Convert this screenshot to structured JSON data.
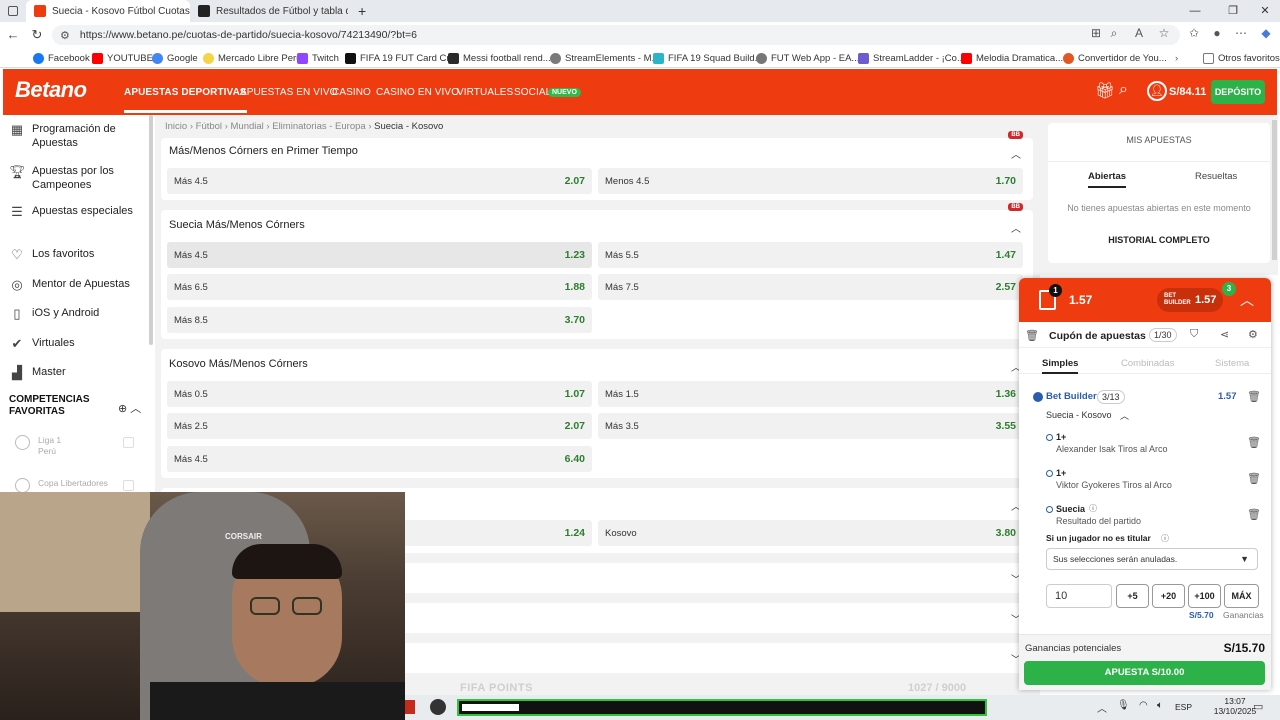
{
  "browser": {
    "tabs": [
      {
        "label": "Suecia - Kosovo Fútbol Cuotas | B",
        "color": "#ee3c10"
      },
      {
        "label": "Resultados de Fútbol y tabla de p",
        "color": "#222222"
      }
    ],
    "url": "https://www.betano.pe/cuotas-de-partido/suecia-kosovo/74213490/?bt=6",
    "bookmarks": [
      {
        "label": "Facebook",
        "color": "#1877f2"
      },
      {
        "label": "YOUTUBE",
        "color": "#ff0000"
      },
      {
        "label": "Google",
        "color": "#4285f4"
      },
      {
        "label": "Mercado Libre Perú",
        "color": "#f5d44a"
      },
      {
        "label": "Twitch",
        "color": "#9146ff"
      },
      {
        "label": "FIFA 19 FUT Card Cr...",
        "color": "#111111"
      },
      {
        "label": "Messi football rend...",
        "color": "#2b2b2b"
      },
      {
        "label": "StreamElements - M...",
        "color": "#7a7a7a"
      },
      {
        "label": "FIFA 19 Squad Build...",
        "color": "#2bb5c8"
      },
      {
        "label": "FUT Web App - EA...",
        "color": "#777777"
      },
      {
        "label": "StreamLadder - ¡Co...",
        "color": "#6d5bd0"
      },
      {
        "label": "Melodia Dramatica...",
        "color": "#ff0000"
      },
      {
        "label": "Convertidor de You...",
        "color": "#e25822"
      }
    ],
    "other_bookmarks": "Otros favoritos"
  },
  "header": {
    "logo": "Betano",
    "nav": [
      "APUESTAS DEPORTIVAS",
      "APUESTAS EN VIVO",
      "CASINO",
      "CASINO EN VIVO",
      "VIRTUALES",
      "SOCIAL"
    ],
    "nuevo": "NUEVO",
    "balance": "S/84.11",
    "deposit": "DEPÓSITO",
    "brand_color": "#ee3c10"
  },
  "sidebar": {
    "items": [
      {
        "label": "Programación de Apuestas",
        "icon": "calendar-icon"
      },
      {
        "label": "Apuestas por los Campeones",
        "icon": "trophy-icon"
      },
      {
        "label": "Apuestas especiales",
        "icon": "sliders-icon"
      },
      {
        "label": "Los favoritos",
        "icon": "heart-icon"
      },
      {
        "label": "Mentor de Apuestas",
        "icon": "target-icon"
      },
      {
        "label": "iOS y Android",
        "icon": "phone-icon"
      },
      {
        "label": "Virtuales",
        "icon": "check-icon"
      },
      {
        "label": "Master",
        "icon": "chart-icon"
      }
    ],
    "competitions_title": "COMPETENCIAS FAVORITAS",
    "leagues": [
      {
        "name": "Liga 1",
        "country": "Perú"
      },
      {
        "name": "Copa Libertadores",
        "country": ""
      }
    ]
  },
  "breadcrumb": {
    "items": [
      "Inicio",
      "Fútbol",
      "Mundial",
      "Eliminatorias - Europa"
    ],
    "current": "Suecia - Kosovo"
  },
  "markets": [
    {
      "title": "Más/Menos Córners en Primer Tiempo",
      "badge": "BB",
      "odds": [
        {
          "label": "Más 4.5",
          "value": "2.07"
        },
        {
          "label": "Menos 4.5",
          "value": "1.70"
        }
      ]
    },
    {
      "title": "Suecia Más/Menos Córners",
      "badge": "BB",
      "odds": [
        {
          "label": "Más 4.5",
          "value": "1.23"
        },
        {
          "label": "Más 5.5",
          "value": "1.47"
        },
        {
          "label": "Más 6.5",
          "value": "1.88"
        },
        {
          "label": "Más 7.5",
          "value": "2.57"
        },
        {
          "label": "Más 8.5",
          "value": "3.70"
        }
      ]
    },
    {
      "title": "Kosovo Más/Menos Córners",
      "badge": "",
      "odds": [
        {
          "label": "Más 0.5",
          "value": "1.07"
        },
        {
          "label": "Más 1.5",
          "value": "1.36"
        },
        {
          "label": "Más 2.5",
          "value": "2.07"
        },
        {
          "label": "Más 3.5",
          "value": "3.55"
        },
        {
          "label": "Más 4.5",
          "value": "6.40"
        }
      ]
    },
    {
      "title": "",
      "badge": "",
      "odds": [
        {
          "label": "",
          "value": "1.24"
        },
        {
          "label": "Kosovo",
          "value": "3.80"
        }
      ]
    }
  ],
  "my_bets": {
    "title": "MIS APUESTAS",
    "tabs": [
      "Abiertas",
      "Resueltas"
    ],
    "empty": "No tienes apuestas abiertas en este momento",
    "history": "HISTORIAL COMPLETO"
  },
  "coupon": {
    "count": "1",
    "total_odds": "1.57",
    "bb_odds": "1.57",
    "bb_count": "3",
    "title": "Cupón de apuestas",
    "pager": "1/30",
    "tabs": [
      "Simples",
      "Combinadas",
      "Sistema"
    ],
    "builder_label": "Bet Builder",
    "builder_count": "3/13",
    "builder_odds": "1.57",
    "match": "Suecia - Kosovo",
    "selections": [
      {
        "pick": "1+",
        "market": "Alexander Isak Tiros al Arco"
      },
      {
        "pick": "1+",
        "market": "Viktor Gyokeres Tiros al Arco"
      },
      {
        "pick": "Suecia",
        "market": "Resultado del partido"
      }
    ],
    "rule_label": "Si un jugador no es titular",
    "rule_value": "Sus selecciones serán anuladas.",
    "stake": "10",
    "quick": [
      "+5",
      "+20",
      "+100",
      "MÁX"
    ],
    "earnings_small": "S/5.70",
    "earnings_label": "Ganancias",
    "potential_label": "Ganancias potenciales",
    "potential_value": "S/15.70",
    "place": "APUESTA S/10.00"
  },
  "overlay": {
    "fifa_points": "FIFA POINTS",
    "counter": "1027 / 9000"
  },
  "taskbar": {
    "lang": "ESP",
    "time": "13:07",
    "date": "13/10/2025"
  }
}
